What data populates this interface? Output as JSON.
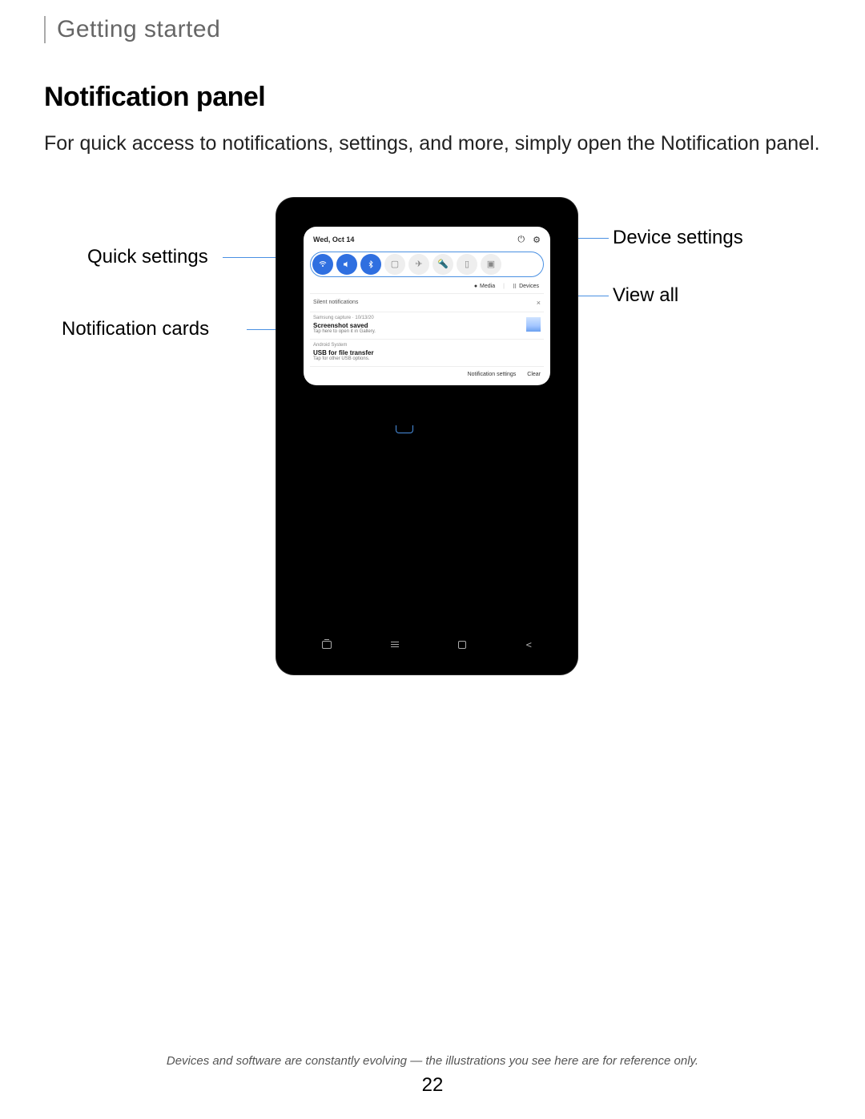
{
  "breadcrumb": "Getting started",
  "section_title": "Notification panel",
  "intro": "For quick access to notifications, settings, and more, simply open the Notification panel.",
  "callouts": {
    "quick_settings": "Quick settings",
    "notification_cards": "Notification cards",
    "device_settings": "Device settings",
    "view_all": "View all"
  },
  "panel": {
    "date": "Wed, Oct 14",
    "power_icon": "power-icon",
    "settings_icon": "gear-icon",
    "quick_settings": [
      "wifi",
      "sound",
      "bluetooth",
      "rotate",
      "airplane",
      "flashlight",
      "battery",
      "screenshot"
    ],
    "media_label": "Media",
    "devices_label": "Devices",
    "silent_label": "Silent notifications",
    "cards": [
      {
        "src": "Samsung capture · 10/13/20",
        "title": "Screenshot saved",
        "sub": "Tap here to open it in Gallery.",
        "thumb": true
      },
      {
        "src": "Android System",
        "title": "USB for file transfer",
        "sub": "Tap for other USB options.",
        "thumb": false
      }
    ],
    "footer_settings": "Notification settings",
    "footer_clear": "Clear"
  },
  "footnote": "Devices and software are constantly evolving — the illustrations you see here are for reference only.",
  "page_number": "22"
}
